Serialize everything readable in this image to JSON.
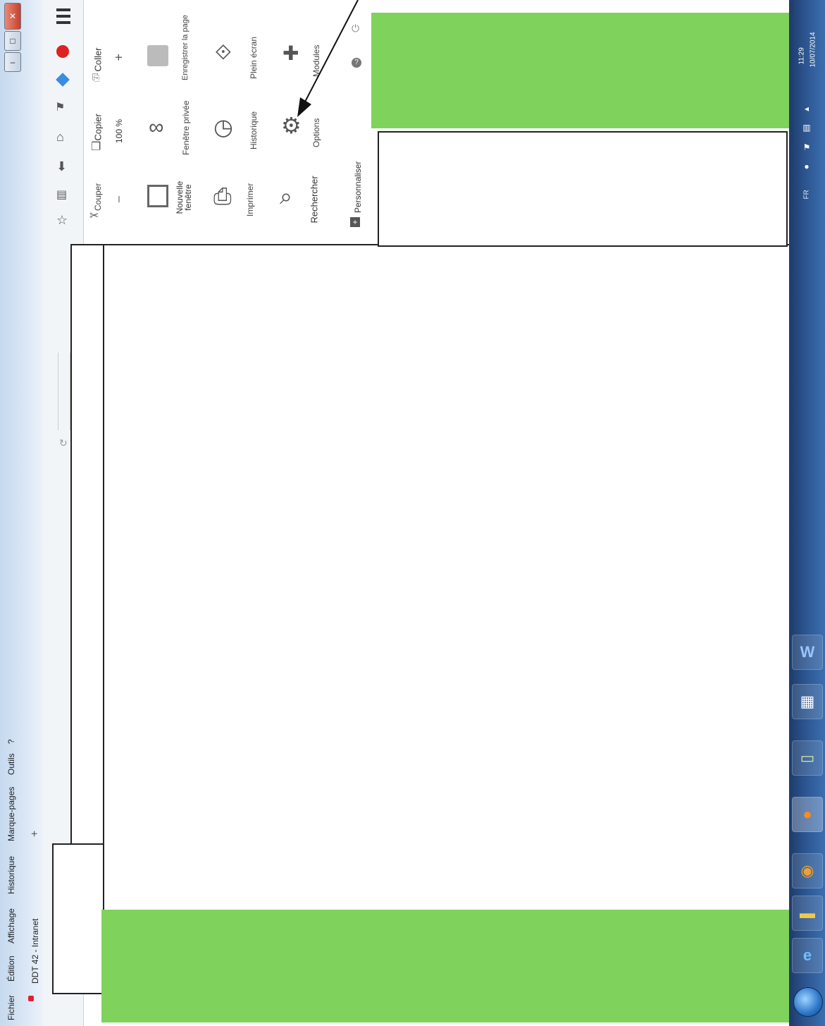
{
  "window": {
    "title": "DDT 42 - Intranet",
    "controls": {
      "minimize": "–",
      "maximize": "□",
      "close": "✕"
    },
    "new_tab": "+"
  },
  "menubar": {
    "items": [
      "Fichier",
      "Édition",
      "Affichage",
      "Historique",
      "Marque-pages",
      "Outils",
      "?"
    ]
  },
  "firefox_menu": {
    "edit_row": {
      "cut": "Couper",
      "copy": "Copier",
      "paste": "Coller"
    },
    "zoom_row": {
      "minus": "–",
      "zoom_value": "100 %",
      "plus": "+"
    },
    "grid": [
      {
        "id": "new-window",
        "label": "Nouvelle fenêtre",
        "icon": "window-icon"
      },
      {
        "id": "private-window",
        "label": "Fenêtre privée",
        "icon": "mask-icon"
      },
      {
        "id": "save-page",
        "label": "Enregistrer la page",
        "icon": "save-page-icon"
      },
      {
        "id": "print",
        "label": "Imprimer",
        "icon": "printer-icon"
      },
      {
        "id": "history",
        "label": "Historique",
        "icon": "clock-icon"
      },
      {
        "id": "fullscreen",
        "label": "Plein écran",
        "icon": "fullscreen-icon"
      },
      {
        "id": "search",
        "label": "Rechercher",
        "icon": "search-icon"
      },
      {
        "id": "options",
        "label": "Options",
        "icon": "gear-icon"
      },
      {
        "id": "addons",
        "label": "Modules",
        "icon": "puzzle-icon"
      }
    ],
    "footer": {
      "customize": "Personnaliser"
    }
  },
  "taskbar": {
    "time": "11:29",
    "date": "10/07/2014",
    "language": "FR"
  },
  "colors": {
    "highlight_green": "#7fd35c",
    "taskbar_blue": "#2c5590"
  }
}
